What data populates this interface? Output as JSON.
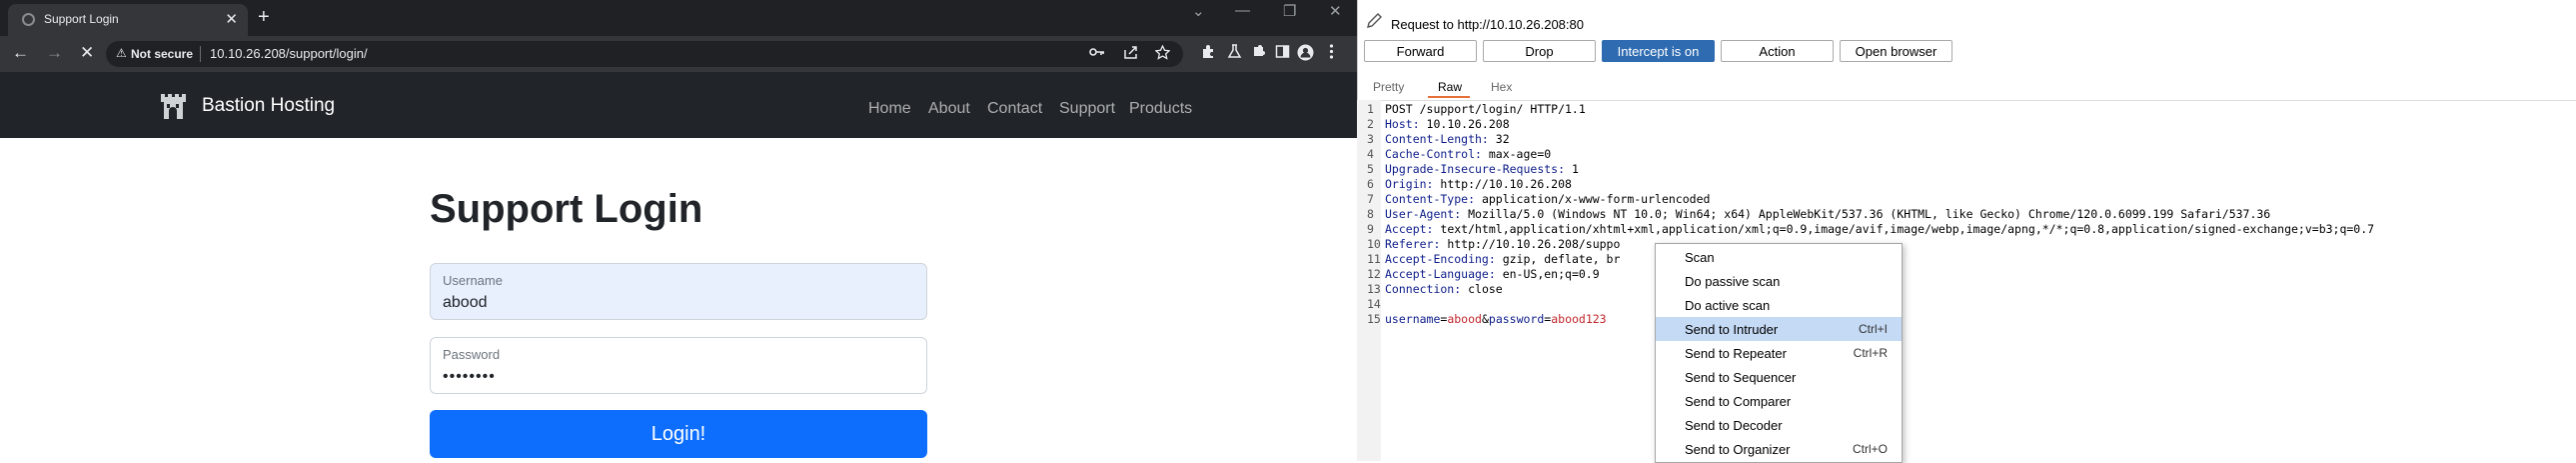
{
  "browser": {
    "tab_title": "Support Login",
    "tab_close": "✕",
    "new_tab": "+",
    "window_controls": [
      "⌄",
      "—",
      "❐",
      "✕"
    ],
    "nav": {
      "back": "←",
      "forward": "→",
      "stop": "✕"
    },
    "address": {
      "warning_icon": "⚠",
      "security_label": "Not secure",
      "url": "10.10.26.208/support/login/"
    },
    "toolbar_icons": [
      "key-icon",
      "share-icon",
      "star-icon",
      "extensions-icon",
      "profile-icon",
      "menu-icon"
    ]
  },
  "site": {
    "brand": "Bastion Hosting",
    "nav": [
      "Home",
      "About",
      "Contact",
      "Support",
      "Products"
    ],
    "heading": "Support Login",
    "username_label": "Username",
    "username_value": "abood",
    "password_label": "Password",
    "password_value": "••••••••",
    "login_button": "Login!",
    "colors": {
      "header_bg": "#212529",
      "button": "#0d6efd",
      "autofill_bg": "#e8f0fe"
    }
  },
  "burp": {
    "request_info": "Request to http://10.10.26.208:80",
    "buttons": {
      "forward": "Forward",
      "drop": "Drop",
      "intercept": "Intercept is on",
      "action": "Action",
      "open_browser": "Open browser"
    },
    "view_tabs": [
      "Pretty",
      "Raw",
      "Hex"
    ],
    "active_view_tab": "Raw",
    "request_lines": [
      {
        "n": "1",
        "name": "",
        "value": "POST /support/login/ HTTP/1.1"
      },
      {
        "n": "2",
        "name": "Host:",
        "value": " 10.10.26.208"
      },
      {
        "n": "3",
        "name": "Content-Length:",
        "value": " 32"
      },
      {
        "n": "4",
        "name": "Cache-Control:",
        "value": " max-age=0"
      },
      {
        "n": "5",
        "name": "Upgrade-Insecure-Requests:",
        "value": " 1"
      },
      {
        "n": "6",
        "name": "Origin:",
        "value": " http://10.10.26.208"
      },
      {
        "n": "7",
        "name": "Content-Type:",
        "value": " application/x-www-form-urlencoded"
      },
      {
        "n": "8",
        "name": "User-Agent:",
        "value": " Mozilla/5.0 (Windows NT 10.0; Win64; x64) AppleWebKit/537.36 (KHTML, like Gecko) Chrome/120.0.6099.199 Safari/537.36"
      },
      {
        "n": "9",
        "name": "Accept:",
        "value": " text/html,application/xhtml+xml,application/xml;q=0.9,image/avif,image/webp,image/apng,*/*;q=0.8,application/signed-exchange;v=b3;q=0.7"
      },
      {
        "n": "10",
        "name": "Referer:",
        "value": " http://10.10.26.208/suppo"
      },
      {
        "n": "11",
        "name": "Accept-Encoding:",
        "value": " gzip, deflate, br"
      },
      {
        "n": "12",
        "name": "Accept-Language:",
        "value": " en-US,en;q=0.9"
      },
      {
        "n": "13",
        "name": "Connection:",
        "value": " close"
      },
      {
        "n": "14",
        "name": "",
        "value": ""
      }
    ],
    "body_line": {
      "n": "15",
      "p1_name": "username",
      "eq1": "=",
      "p1_value": "abood",
      "amp": "&",
      "p2_name": "password",
      "eq2": "=",
      "p2_value": "abood123"
    },
    "context_menu": [
      {
        "label": "Scan",
        "shortcut": ""
      },
      {
        "label": "Do passive scan",
        "shortcut": ""
      },
      {
        "label": "Do active scan",
        "shortcut": ""
      },
      {
        "label": "Send to Intruder",
        "shortcut": "Ctrl+I",
        "highlighted": true
      },
      {
        "label": "Send to Repeater",
        "shortcut": "Ctrl+R"
      },
      {
        "label": "Send to Sequencer",
        "shortcut": ""
      },
      {
        "label": "Send to Comparer",
        "shortcut": ""
      },
      {
        "label": "Send to Decoder",
        "shortcut": ""
      },
      {
        "label": "Send to Organizer",
        "shortcut": "Ctrl+O"
      }
    ]
  }
}
